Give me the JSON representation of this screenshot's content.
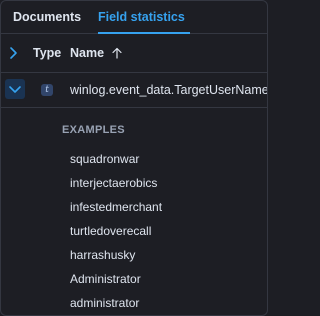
{
  "tabs": [
    {
      "label": "Documents",
      "active": false
    },
    {
      "label": "Field statistics",
      "active": true
    }
  ],
  "table": {
    "columns": {
      "type": "Type",
      "name": "Name"
    },
    "sort": "ascending",
    "row": {
      "type_badge": "t",
      "field_name": "winlog.event_data.TargetUserName",
      "expanded": true
    }
  },
  "examples": {
    "title": "EXAMPLES",
    "items": [
      "squadronwar",
      "interjectaerobics",
      "infestedmerchant",
      "turtledoverecall",
      "harrashusky",
      "Administrator",
      "administrator"
    ]
  },
  "colors": {
    "background": "#1d1e24",
    "accent": "#36a2ef",
    "border": "#343741",
    "text": "#dfe5ef",
    "muted": "#98a2b3"
  }
}
